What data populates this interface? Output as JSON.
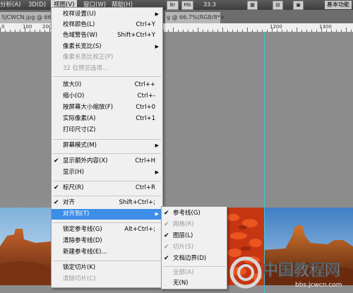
{
  "menubar": {
    "items": [
      {
        "label": "分析(A)"
      },
      {
        "label": "3D(D)"
      },
      {
        "label": "视图(V)",
        "active": true
      },
      {
        "label": "窗口(W)"
      },
      {
        "label": "帮助(H)"
      }
    ],
    "buttons": [
      "Br",
      "Mb"
    ],
    "zoom": "33.3",
    "workspace": "基本功能"
  },
  "tabs": [
    {
      "label": "5JCWCN.jpg @ 66"
    },
    {
      "label": "g @ 66.7%(RGB/8*)"
    }
  ],
  "ruler": {
    "labels": [
      "0",
      "100",
      "200",
      "1200",
      "1300"
    ]
  },
  "view_menu": {
    "items": [
      {
        "label": "校样设置(U)",
        "shortcut": "",
        "submenu": true
      },
      {
        "label": "校样颜色(L)",
        "shortcut": "Ctrl+Y"
      },
      {
        "label": "色域警告(W)",
        "shortcut": "Shift+Ctrl+Y"
      },
      {
        "label": "像素长宽比(S)",
        "shortcut": "",
        "submenu": true
      },
      {
        "label": "像素长宽比校正(P)",
        "shortcut": "",
        "disabled": true
      },
      {
        "label": "32 位预览选项...",
        "shortcut": "",
        "disabled": true
      },
      {
        "label": "放大(I)",
        "shortcut": "Ctrl++"
      },
      {
        "label": "缩小(O)",
        "shortcut": "Ctrl+-"
      },
      {
        "label": "按屏幕大小缩放(F)",
        "shortcut": "Ctrl+0"
      },
      {
        "label": "实际像素(A)",
        "shortcut": "Ctrl+1"
      },
      {
        "label": "打印尺寸(Z)",
        "shortcut": ""
      },
      {
        "label": "屏幕模式(M)",
        "shortcut": "",
        "submenu": true
      },
      {
        "label": "显示额外内容(X)",
        "shortcut": "Ctrl+H",
        "checked": true
      },
      {
        "label": "显示(H)",
        "shortcut": "",
        "submenu": true
      },
      {
        "label": "标尺(R)",
        "shortcut": "Ctrl+R",
        "checked": true
      },
      {
        "label": "对齐",
        "shortcut": "Shift+Ctrl+;",
        "checked": true
      },
      {
        "label": "对齐到(T)",
        "shortcut": "",
        "submenu": true,
        "highlighted": true
      },
      {
        "label": "锁定参考线(G)",
        "shortcut": "Alt+Ctrl+;"
      },
      {
        "label": "清除参考线(D)",
        "shortcut": ""
      },
      {
        "label": "新建参考线(E)...",
        "shortcut": ""
      },
      {
        "label": "锁定切片(K)",
        "shortcut": ""
      },
      {
        "label": "清除切片(C)",
        "shortcut": "",
        "disabled": true
      }
    ]
  },
  "snap_menu": {
    "items": [
      {
        "label": "参考线(G)",
        "checked": true
      },
      {
        "label": "网格(R)",
        "checked": true,
        "disabled": true
      },
      {
        "label": "图层(L)",
        "checked": true
      },
      {
        "label": "切片(S)",
        "checked": true,
        "disabled": true
      },
      {
        "label": "文档边界(D)",
        "checked": true
      },
      {
        "label": "全部(A)",
        "disabled": true
      },
      {
        "label": "无(N)"
      }
    ]
  },
  "watermark": {
    "text": "中国教程网",
    "sub": "bbs.jcwcn.com"
  },
  "colors": {
    "highlight": "#3d8ee6",
    "guide": "#35c6d8",
    "menu_bg": "#f0f0f0"
  }
}
